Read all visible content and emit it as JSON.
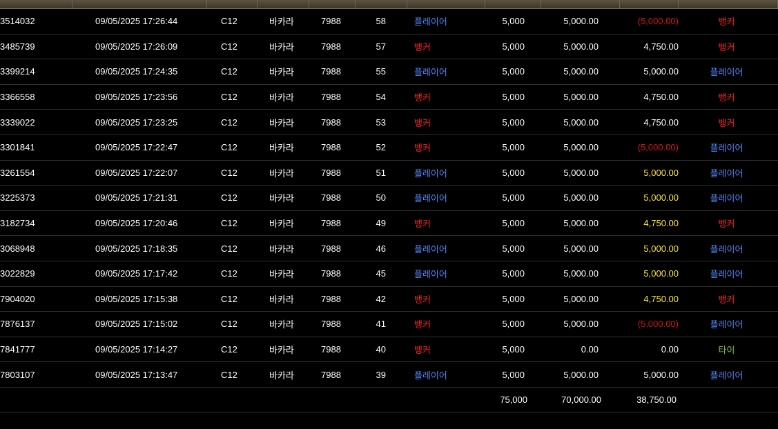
{
  "colors": {
    "player": "#4f86f7",
    "banker": "#ff2020",
    "tie": "#7ec34a",
    "negative": "#d4161b",
    "highlight": "#ffe83a"
  },
  "rows": [
    {
      "id": "3514032",
      "datetime": "09/05/2025 17:26:44",
      "table": "C12",
      "game": "바카라",
      "round": "7988",
      "seq": "58",
      "bet": "플레이어",
      "bet_type": "player",
      "amount": "5,000",
      "valid": "5,000.00",
      "winloss": "(5,000.00)",
      "winloss_style": "neg",
      "result": "뱅커",
      "result_type": "banker"
    },
    {
      "id": "3485739",
      "datetime": "09/05/2025 17:26:09",
      "table": "C12",
      "game": "바카라",
      "round": "7988",
      "seq": "57",
      "bet": "뱅커",
      "bet_type": "banker",
      "amount": "5,000",
      "valid": "5,000.00",
      "winloss": "4,750.00",
      "winloss_style": "white",
      "result": "뱅커",
      "result_type": "banker"
    },
    {
      "id": "3399214",
      "datetime": "09/05/2025 17:24:35",
      "table": "C12",
      "game": "바카라",
      "round": "7988",
      "seq": "55",
      "bet": "플레이어",
      "bet_type": "player",
      "amount": "5,000",
      "valid": "5,000.00",
      "winloss": "5,000.00",
      "winloss_style": "white",
      "result": "플레이어",
      "result_type": "player"
    },
    {
      "id": "3366558",
      "datetime": "09/05/2025 17:23:56",
      "table": "C12",
      "game": "바카라",
      "round": "7988",
      "seq": "54",
      "bet": "뱅커",
      "bet_type": "banker",
      "amount": "5,000",
      "valid": "5,000.00",
      "winloss": "4,750.00",
      "winloss_style": "white",
      "result": "뱅커",
      "result_type": "banker"
    },
    {
      "id": "3339022",
      "datetime": "09/05/2025 17:23:25",
      "table": "C12",
      "game": "바카라",
      "round": "7988",
      "seq": "53",
      "bet": "뱅커",
      "bet_type": "banker",
      "amount": "5,000",
      "valid": "5,000.00",
      "winloss": "4,750.00",
      "winloss_style": "white",
      "result": "뱅커",
      "result_type": "banker"
    },
    {
      "id": "3301841",
      "datetime": "09/05/2025 17:22:47",
      "table": "C12",
      "game": "바카라",
      "round": "7988",
      "seq": "52",
      "bet": "뱅커",
      "bet_type": "banker",
      "amount": "5,000",
      "valid": "5,000.00",
      "winloss": "(5,000.00)",
      "winloss_style": "neg",
      "result": "플레이어",
      "result_type": "player"
    },
    {
      "id": "3261554",
      "datetime": "09/05/2025 17:22:07",
      "table": "C12",
      "game": "바카라",
      "round": "7988",
      "seq": "51",
      "bet": "플레이어",
      "bet_type": "player",
      "amount": "5,000",
      "valid": "5,000.00",
      "winloss": "5,000.00",
      "winloss_style": "yellow",
      "result": "플레이어",
      "result_type": "player"
    },
    {
      "id": "3225373",
      "datetime": "09/05/2025 17:21:31",
      "table": "C12",
      "game": "바카라",
      "round": "7988",
      "seq": "50",
      "bet": "플레이어",
      "bet_type": "player",
      "amount": "5,000",
      "valid": "5,000.00",
      "winloss": "5,000.00",
      "winloss_style": "yellow",
      "result": "플레이어",
      "result_type": "player"
    },
    {
      "id": "3182734",
      "datetime": "09/05/2025 17:20:46",
      "table": "C12",
      "game": "바카라",
      "round": "7988",
      "seq": "49",
      "bet": "뱅커",
      "bet_type": "banker",
      "amount": "5,000",
      "valid": "5,000.00",
      "winloss": "4,750.00",
      "winloss_style": "yellow",
      "result": "뱅커",
      "result_type": "banker"
    },
    {
      "id": "3068948",
      "datetime": "09/05/2025 17:18:35",
      "table": "C12",
      "game": "바카라",
      "round": "7988",
      "seq": "46",
      "bet": "플레이어",
      "bet_type": "player",
      "amount": "5,000",
      "valid": "5,000.00",
      "winloss": "5,000.00",
      "winloss_style": "yellow",
      "result": "플레이어",
      "result_type": "player"
    },
    {
      "id": "3022829",
      "datetime": "09/05/2025 17:17:42",
      "table": "C12",
      "game": "바카라",
      "round": "7988",
      "seq": "45",
      "bet": "플레이어",
      "bet_type": "player",
      "amount": "5,000",
      "valid": "5,000.00",
      "winloss": "5,000.00",
      "winloss_style": "yellow",
      "result": "플레이어",
      "result_type": "player"
    },
    {
      "id": "7904020",
      "datetime": "09/05/2025 17:15:38",
      "table": "C12",
      "game": "바카라",
      "round": "7988",
      "seq": "42",
      "bet": "뱅커",
      "bet_type": "banker",
      "amount": "5,000",
      "valid": "5,000.00",
      "winloss": "4,750.00",
      "winloss_style": "yellow",
      "result": "뱅커",
      "result_type": "banker"
    },
    {
      "id": "7876137",
      "datetime": "09/05/2025 17:15:02",
      "table": "C12",
      "game": "바카라",
      "round": "7988",
      "seq": "41",
      "bet": "뱅커",
      "bet_type": "banker",
      "amount": "5,000",
      "valid": "5,000.00",
      "winloss": "(5,000.00)",
      "winloss_style": "neg",
      "result": "플레이어",
      "result_type": "player"
    },
    {
      "id": "7841777",
      "datetime": "09/05/2025 17:14:27",
      "table": "C12",
      "game": "바카라",
      "round": "7988",
      "seq": "40",
      "bet": "뱅커",
      "bet_type": "banker",
      "amount": "5,000",
      "valid": "0.00",
      "winloss": "0.00",
      "winloss_style": "white",
      "result": "타이",
      "result_type": "tie"
    },
    {
      "id": "7803107",
      "datetime": "09/05/2025 17:13:47",
      "table": "C12",
      "game": "바카라",
      "round": "7988",
      "seq": "39",
      "bet": "플레이어",
      "bet_type": "player",
      "amount": "5,000",
      "valid": "5,000.00",
      "winloss": "5,000.00",
      "winloss_style": "white",
      "result": "플레이어",
      "result_type": "player"
    }
  ],
  "totals": {
    "amount": "75,000",
    "valid": "70,000.00",
    "winloss": "38,750.00"
  }
}
